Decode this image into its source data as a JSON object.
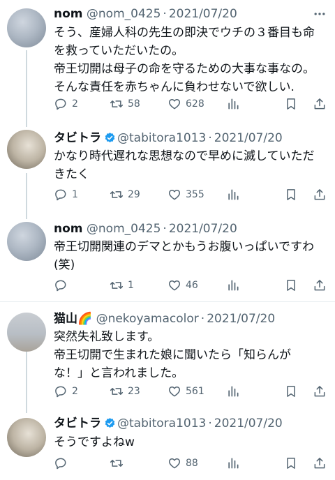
{
  "tweets": [
    {
      "name": "nom",
      "handle": "@nom_0425",
      "date": "2021/07/20",
      "verified": false,
      "lines": [
        "そう、産婦人科の先生の即決でウチの３番目も命",
        "を救っていただいたの。",
        "帝王切開は母子の命を守るための大事な事なの。",
        "そんな責任を赤ちゃんに負わせないで欲しい."
      ],
      "replies": "2",
      "retweets": "58",
      "likes": "628"
    },
    {
      "name": "タビトラ",
      "handle": "@tabitora1013",
      "date": "2021/07/20",
      "verified": true,
      "lines": [
        "かなり時代遅れな思想なので早めに滅していただ",
        "きたく"
      ],
      "replies": "1",
      "retweets": "29",
      "likes": "355"
    },
    {
      "name": "nom",
      "handle": "@nom_0425",
      "date": "2021/07/20",
      "verified": false,
      "lines": [
        "帝王切開関連のデマとかもうお腹いっぱいですわ",
        "(笑)"
      ],
      "replies": "",
      "retweets": "1",
      "likes": "46"
    },
    {
      "name": "猫山🌈",
      "handle": "@nekoyamacolor",
      "date": "2021/07/20",
      "verified": false,
      "lines": [
        "突然失礼致します。",
        "帝王切開で生まれた娘に聞いたら「知らんが",
        "な！」と言われました。"
      ],
      "replies": "2",
      "retweets": "23",
      "likes": "561"
    },
    {
      "name": "タビトラ",
      "handle": "@tabitora1013",
      "date": "2021/07/20",
      "verified": true,
      "lines": [
        "そうですよねw"
      ],
      "replies": "",
      "retweets": "",
      "likes": "88"
    }
  ],
  "icons": {
    "reply": "reply-icon",
    "retweet": "retweet-icon",
    "like": "heart-icon",
    "views": "views-icon",
    "bookmark": "bookmark-icon",
    "share": "share-icon",
    "more": "more-icon",
    "verified": "verified-badge-icon"
  },
  "colors": {
    "text": "#0f1419",
    "secondary": "#536471",
    "verified": "#1d9bf0",
    "divider": "#e6ecf0",
    "thread_line": "#cfd9de"
  }
}
